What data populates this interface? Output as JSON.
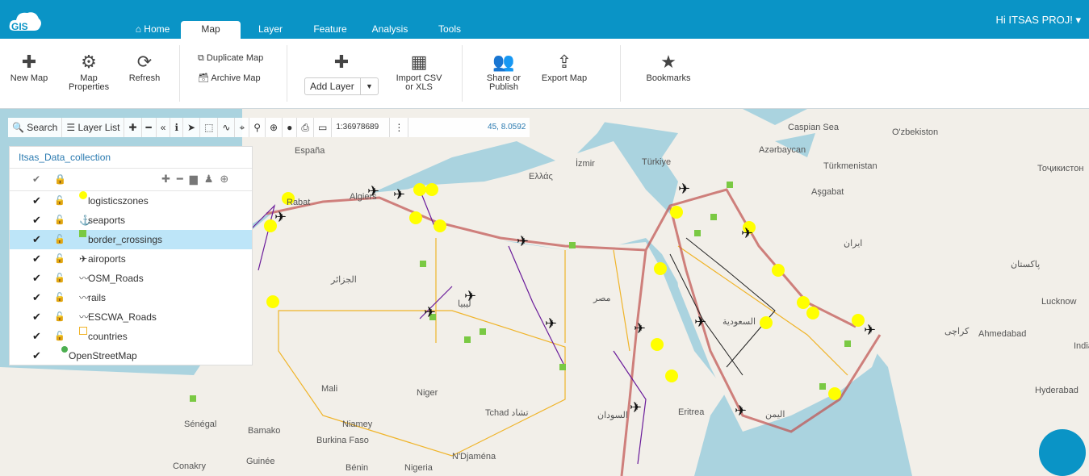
{
  "header": {
    "logo": "GIS",
    "greeting": "Hi ITSAS PROJ! ▾",
    "tabs": [
      {
        "label": "Home"
      },
      {
        "label": "Map"
      },
      {
        "label": "Layer"
      },
      {
        "label": "Feature"
      },
      {
        "label": "Analysis"
      },
      {
        "label": "Tools"
      }
    ],
    "active_tab": "Map"
  },
  "ribbon": {
    "new_map": "New Map",
    "map_properties": "Map Properties",
    "refresh": "Refresh",
    "duplicate_map": "Duplicate Map",
    "archive_map": "Archive Map",
    "add_layer": "Add Layer",
    "import_csv": "Import CSV or XLS",
    "share": "Share or Publish",
    "export_map": "Export Map",
    "bookmarks": "Bookmarks"
  },
  "toolbar": {
    "search": "Search",
    "layer_list": "Layer List",
    "scale": "1:36978689",
    "coords": "45, 8.0592"
  },
  "layer_panel": {
    "title": "Itsas_Data_collection",
    "layers": [
      {
        "name": "logisticszones",
        "symbol": "yellow-circle",
        "selected": false
      },
      {
        "name": "seaports",
        "symbol": "anchor",
        "selected": false
      },
      {
        "name": "border_crossings",
        "symbol": "green-square",
        "selected": true
      },
      {
        "name": "airoports",
        "symbol": "plane",
        "selected": false
      },
      {
        "name": "OSM_Roads",
        "symbol": "line",
        "selected": false
      },
      {
        "name": "rails",
        "symbol": "line",
        "selected": false
      },
      {
        "name": "ESCWA_Roads",
        "symbol": "line",
        "selected": false
      },
      {
        "name": "countries",
        "symbol": "yellow-square-outline",
        "selected": false
      },
      {
        "name": "OpenStreetMap",
        "symbol": "globe",
        "selected": false
      }
    ]
  },
  "map_labels": [
    "España",
    "Ελλάς",
    "İzmir",
    "Türkiye",
    "Azərbaycan",
    "Türkmenistan",
    "Aşgabat",
    "O'zbekiston",
    "Тоҷикистон",
    "Rabat",
    "Algiers",
    "الجزائر",
    "ليبيا",
    "مصر",
    "السعودية",
    "Mali",
    "Niger",
    "Tchad تشاد",
    "السودان",
    "Eritrea",
    "اليمن",
    "Sénégal",
    "Bamako",
    "Niamey",
    "Burkina Faso",
    "N'Djaména",
    "Nigeria",
    "Conakry",
    "Guinée",
    "Bénin",
    "كراچی",
    "Ahmedabad",
    "India",
    "Hyderabad",
    "Lucknow",
    "پاکستان",
    "ایران",
    "Caspian Sea"
  ],
  "colors": {
    "header": "#0a94c6",
    "land": "#f2efe9",
    "sea": "#aad3df",
    "logistics": "#ffff00",
    "border": "#7ac943",
    "roads": "#c0504d",
    "rails": "#6a1b9a",
    "countries": "#f0b429"
  }
}
